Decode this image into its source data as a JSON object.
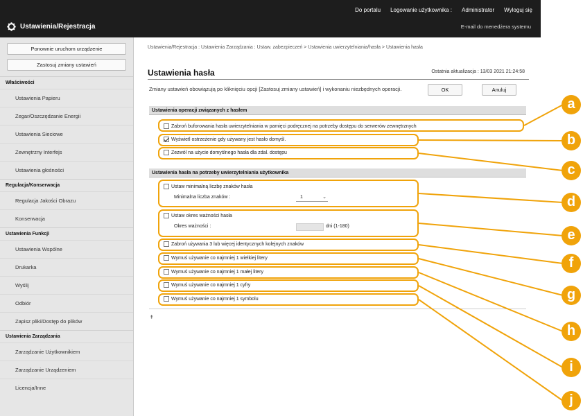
{
  "header": {
    "links": [
      "Do portalu",
      "Logowanie użytkownika :",
      "Administrator",
      "Wyloguj się"
    ],
    "app_title": "Ustawienia/Rejestracja",
    "admin_email": "E-mail do menedżera systemu"
  },
  "sidebar": {
    "buttons": [
      "Ponownie uruchom urządzenie",
      "Zastosuj zmiany ustawień"
    ],
    "sections": [
      {
        "title": "Właściwości",
        "items": [
          "Ustawienia Papieru",
          "Zegar/Oszczędzanie Energii",
          "Ustawienia Sieciowe",
          "Zewnętrzny Interfejs",
          "Ustawienia głośności"
        ]
      },
      {
        "title": "Regulacja/Konserwacja",
        "items": [
          "Regulacja Jakości Obrazu",
          "Konserwacja"
        ]
      },
      {
        "title": "Ustawienia Funkcji",
        "items": [
          "Ustawienia Wspólne",
          "Drukarka",
          "Wyślij",
          "Odbiór",
          "Zapisz pliki/Dostęp do plików"
        ]
      },
      {
        "title": "Ustawienia Zarządzania",
        "items": [
          "Zarządzanie Użytkownikiem",
          "Zarządzanie Urządzeniem",
          "Licencja/Inne"
        ]
      }
    ]
  },
  "main": {
    "breadcrumb": "Ustawienia/Rejestracja : Ustawienia Zarządzania : Ustaw. zabezpieczeń > Ustawienia uwierzytelniania/hasła > Ustawienia hasła",
    "title": "Ustawienia hasła",
    "last_update": "Ostatnia aktualizacja : 13/03 2021 21:24:58",
    "description": "Zmiany ustawień obowiązują po kliknięciu opcji [Zastosuj zmiany ustawień] i wykonaniu niezbędnych operacji.",
    "ok_label": "OK",
    "cancel_label": "Anuluj",
    "section1_title": "Ustawienia operacji związanych z hasłem",
    "section1_options": [
      {
        "label": "Zabroń buforowania hasła uwierzytelniania w pamięci podręcznej na potrzeby dostępu do serwerów zewnętrznych",
        "checked": false
      },
      {
        "label": "Wyświetl ostrzeżenie gdy używany jest hasło domyśl.",
        "checked": true
      },
      {
        "label": "Zezwól na użycie domyślnego hasła dla zdal. dostępu",
        "checked": false
      }
    ],
    "section2_title": "Ustawienia hasła na potrzeby uwierzytelniania użytkownika",
    "min_length_label": "Ustaw minimalną liczbę znaków hasła",
    "min_length_sub": "Minimalna liczba znaków :",
    "min_length_value": "1",
    "validity_label": "Ustaw okres ważności hasła",
    "validity_sub": "Okres ważności :",
    "validity_unit": "dni (1-180)",
    "section2_options": [
      "Zabroń używania 3 lub więcej identycznych kolejnych znaków",
      "Wymuś używanie co najmniej 1 wielkiej litery",
      "Wymuś używanie co najmniej 1 małej litery",
      "Wymuś używanie co najmniej 1 cyfry",
      "Wymuś używanie co najmniej 1 symbolu"
    ],
    "back_to_top": "⯒"
  },
  "callouts": {
    "letters": [
      "a",
      "b",
      "c",
      "d",
      "e",
      "f",
      "g",
      "h",
      "i",
      "j"
    ],
    "color": "#f0a30a"
  }
}
